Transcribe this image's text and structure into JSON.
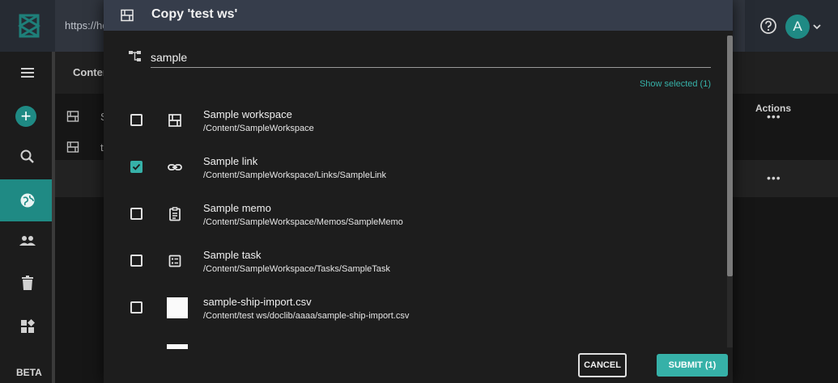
{
  "topbar": {
    "url_text": "https://he"
  },
  "avatar": {
    "initial": "A"
  },
  "sidebar": {
    "beta_label": "BETA"
  },
  "main": {
    "header_title": "Conter",
    "actions_header": "Actions",
    "rows": [
      {
        "label": "S",
        "action": "•••"
      },
      {
        "label": "t",
        "action": "•••"
      }
    ]
  },
  "dialog": {
    "title": "Copy 'test ws'",
    "search_value": "sample",
    "show_selected": "Show selected (1)",
    "items": [
      {
        "name": "Sample workspace",
        "path": "/Content/SampleWorkspace",
        "checked": false,
        "icon": "workspace-icon"
      },
      {
        "name": "Sample link",
        "path": "/Content/SampleWorkspace/Links/SampleLink",
        "checked": true,
        "icon": "link-icon"
      },
      {
        "name": "Sample memo",
        "path": "/Content/SampleWorkspace/Memos/SampleMemo",
        "checked": false,
        "icon": "memo-icon"
      },
      {
        "name": "Sample task",
        "path": "/Content/SampleWorkspace/Tasks/SampleTask",
        "checked": false,
        "icon": "task-icon"
      },
      {
        "name": "sample-ship-import.csv",
        "path": "/Content/test ws/doclib/aaaa/sample-ship-import.csv",
        "checked": false,
        "icon": "file-thumbnail"
      }
    ],
    "cancel_label": "CANCEL",
    "submit_label": "SUBMIT (1)"
  },
  "colors": {
    "accent": "#36b1a8",
    "header": "#363d4b",
    "dialog_bg": "#1d1d1d"
  }
}
